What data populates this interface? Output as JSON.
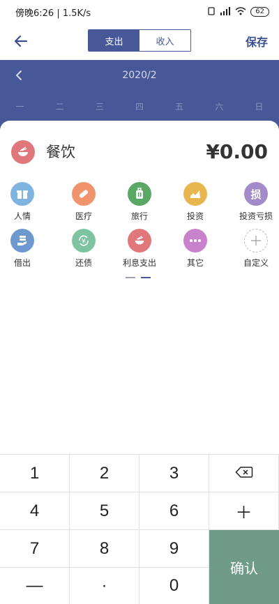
{
  "status": {
    "time_speed": "傍晚6:26 | 1.5K/s",
    "battery": "62"
  },
  "toolbar": {
    "tab_expense": "支出",
    "tab_income": "收入",
    "save_label": "保存"
  },
  "calendar": {
    "month": "2020/2",
    "weekdays": [
      "一",
      "二",
      "三",
      "四",
      "五",
      "六",
      "日"
    ]
  },
  "selected": {
    "name": "餐饮",
    "amount": "¥0.00"
  },
  "categories": [
    {
      "label": "人情",
      "icon": "gift-icon",
      "color": "#7fb3e0"
    },
    {
      "label": "医疗",
      "icon": "pill-icon",
      "color": "#ef946c"
    },
    {
      "label": "旅行",
      "icon": "luggage-icon",
      "color": "#5aa766"
    },
    {
      "label": "投资",
      "icon": "trend-chart-icon",
      "color": "#e7b64e"
    },
    {
      "label": "投资亏损",
      "icon": "loss-char-icon",
      "glyph": "损",
      "color": "#a38ac9"
    },
    {
      "label": "借出",
      "icon": "lend-hand-icon",
      "color": "#6e99cf"
    },
    {
      "label": "还债",
      "icon": "repay-yen-icon",
      "color": "#7ec4a0"
    },
    {
      "label": "利息支出",
      "icon": "bowl-icon",
      "color": "#e0777b"
    },
    {
      "label": "其它",
      "icon": "more-dots-icon",
      "color": "#c882cc"
    },
    {
      "label": "自定义",
      "icon": "add-custom-icon",
      "color": "#ffffff"
    }
  ],
  "keypad": {
    "keys": [
      "1",
      "2",
      "3",
      "4",
      "5",
      "6",
      "7",
      "8",
      "9",
      "—",
      "·",
      "0"
    ],
    "plus": "＋",
    "confirm": "确认"
  }
}
